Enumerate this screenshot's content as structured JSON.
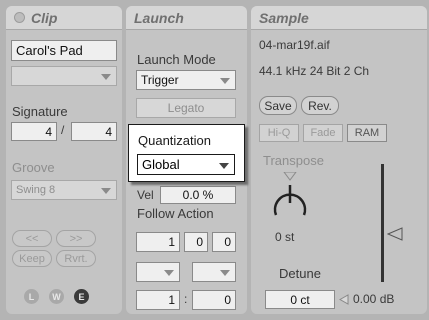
{
  "clip": {
    "title": "Clip",
    "name_value": "Carol's Pad",
    "signature_label": "Signature",
    "sig_numerator": "4",
    "sig_separator": "/",
    "sig_denominator": "4",
    "groove_label": "Groove",
    "groove_value": "Swing 8",
    "nudge_back": "<<",
    "nudge_fwd": ">>",
    "keep_label": "Keep",
    "rvrt_label": "Rvrt.",
    "footer_buttons": [
      "L",
      "W",
      "E"
    ]
  },
  "launch": {
    "title": "Launch",
    "launch_mode_label": "Launch Mode",
    "launch_mode_value": "Trigger",
    "legato_label": "Legato",
    "quantization_label": "Quantization",
    "quantization_value": "Global",
    "vel_label": "Vel",
    "vel_value": "0.0 %",
    "follow_action_label": "Follow Action",
    "follow_time": [
      "1",
      "0",
      "0"
    ],
    "chance_a": "1",
    "chance_sep": ":",
    "chance_b": "0"
  },
  "sample": {
    "title": "Sample",
    "file_name": "04-mar19f.aif",
    "file_info": "44.1 kHz 24 Bit 2 Ch",
    "save_label": "Save",
    "rev_label": "Rev.",
    "hiq_label": "Hi-Q",
    "fade_label": "Fade",
    "ram_label": "RAM",
    "transpose_label": "Transpose",
    "transpose_value": "0 st",
    "detune_label": "Detune",
    "detune_value": "0 ct",
    "gain_value": "0.00 dB"
  },
  "colors": {
    "panel_bg": "#c4c4c4",
    "header_bg": "#d6d6d6",
    "field_bg": "#efefef",
    "edit_button": "#3a3a3a"
  }
}
